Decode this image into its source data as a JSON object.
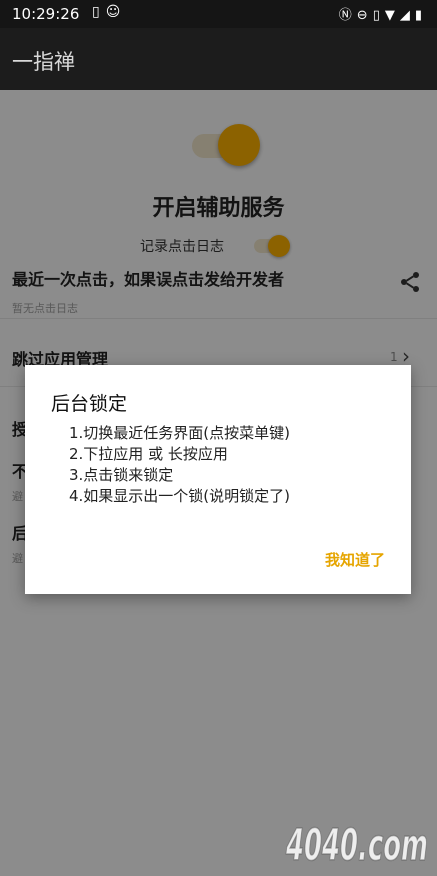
{
  "status_bar": {
    "time": "10:29:26"
  },
  "app_bar": {
    "title": "一指禅"
  },
  "main": {
    "service_title": "开启辅助服务",
    "log_toggle_label": "记录点击日志",
    "recent_title": "最近一次点击，如果误点击发给开发者",
    "recent_sub": "暂无点击日志",
    "skip_title": "跳过应用管理",
    "skip_count": "1",
    "row3_title": "授",
    "row4_title": "不",
    "row4_sub": "避",
    "row5_title": "后",
    "row5_sub": "避"
  },
  "dialog": {
    "title": "后台锁定",
    "steps": [
      "1.切换最近任务界面(点按菜单键)",
      "2.下拉应用 或 长按应用",
      "3.点击锁来锁定",
      "4.如果显示出一个锁(说明锁定了)"
    ],
    "confirm_label": "我知道了"
  },
  "watermark": {
    "text": "4040.com"
  },
  "colors": {
    "accent": "#f2a900",
    "dialog_action": "#e6a500",
    "app_bar": "#1c1c1c"
  }
}
